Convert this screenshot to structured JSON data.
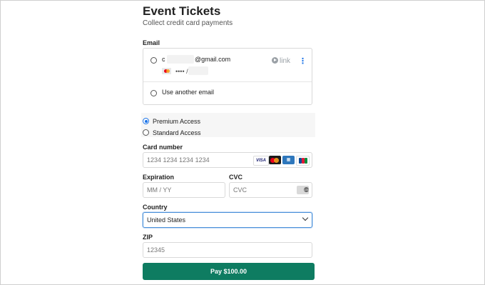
{
  "header": {
    "title": "Event Tickets",
    "subtitle": "Collect credit card payments"
  },
  "email": {
    "label": "Email",
    "saved_account": {
      "email_prefix": "c",
      "email_domain": "@gmail.com",
      "card_mask": "•••• /",
      "link_label": "link",
      "menu_glyph": "⋮"
    },
    "another_email_label": "Use another email"
  },
  "plans": {
    "options": [
      "Premium Access",
      "Standard Access"
    ],
    "selected": "Premium Access"
  },
  "card": {
    "label": "Card number",
    "placeholder": "1234 1234 1234 1234",
    "brands": [
      "VISA",
      "mastercard",
      "amex",
      "jcb"
    ]
  },
  "expiration": {
    "label": "Expiration",
    "placeholder": "MM / YY"
  },
  "cvc": {
    "label": "CVC",
    "placeholder": "CVC"
  },
  "country": {
    "label": "Country",
    "value": "United States"
  },
  "zip": {
    "label": "ZIP",
    "placeholder": "12345"
  },
  "pay_button": {
    "label": "Pay $100.00"
  },
  "colors": {
    "accent": "#1a73e8",
    "pay_button": "#0e7c61",
    "focus_border": "#4a90d9"
  }
}
